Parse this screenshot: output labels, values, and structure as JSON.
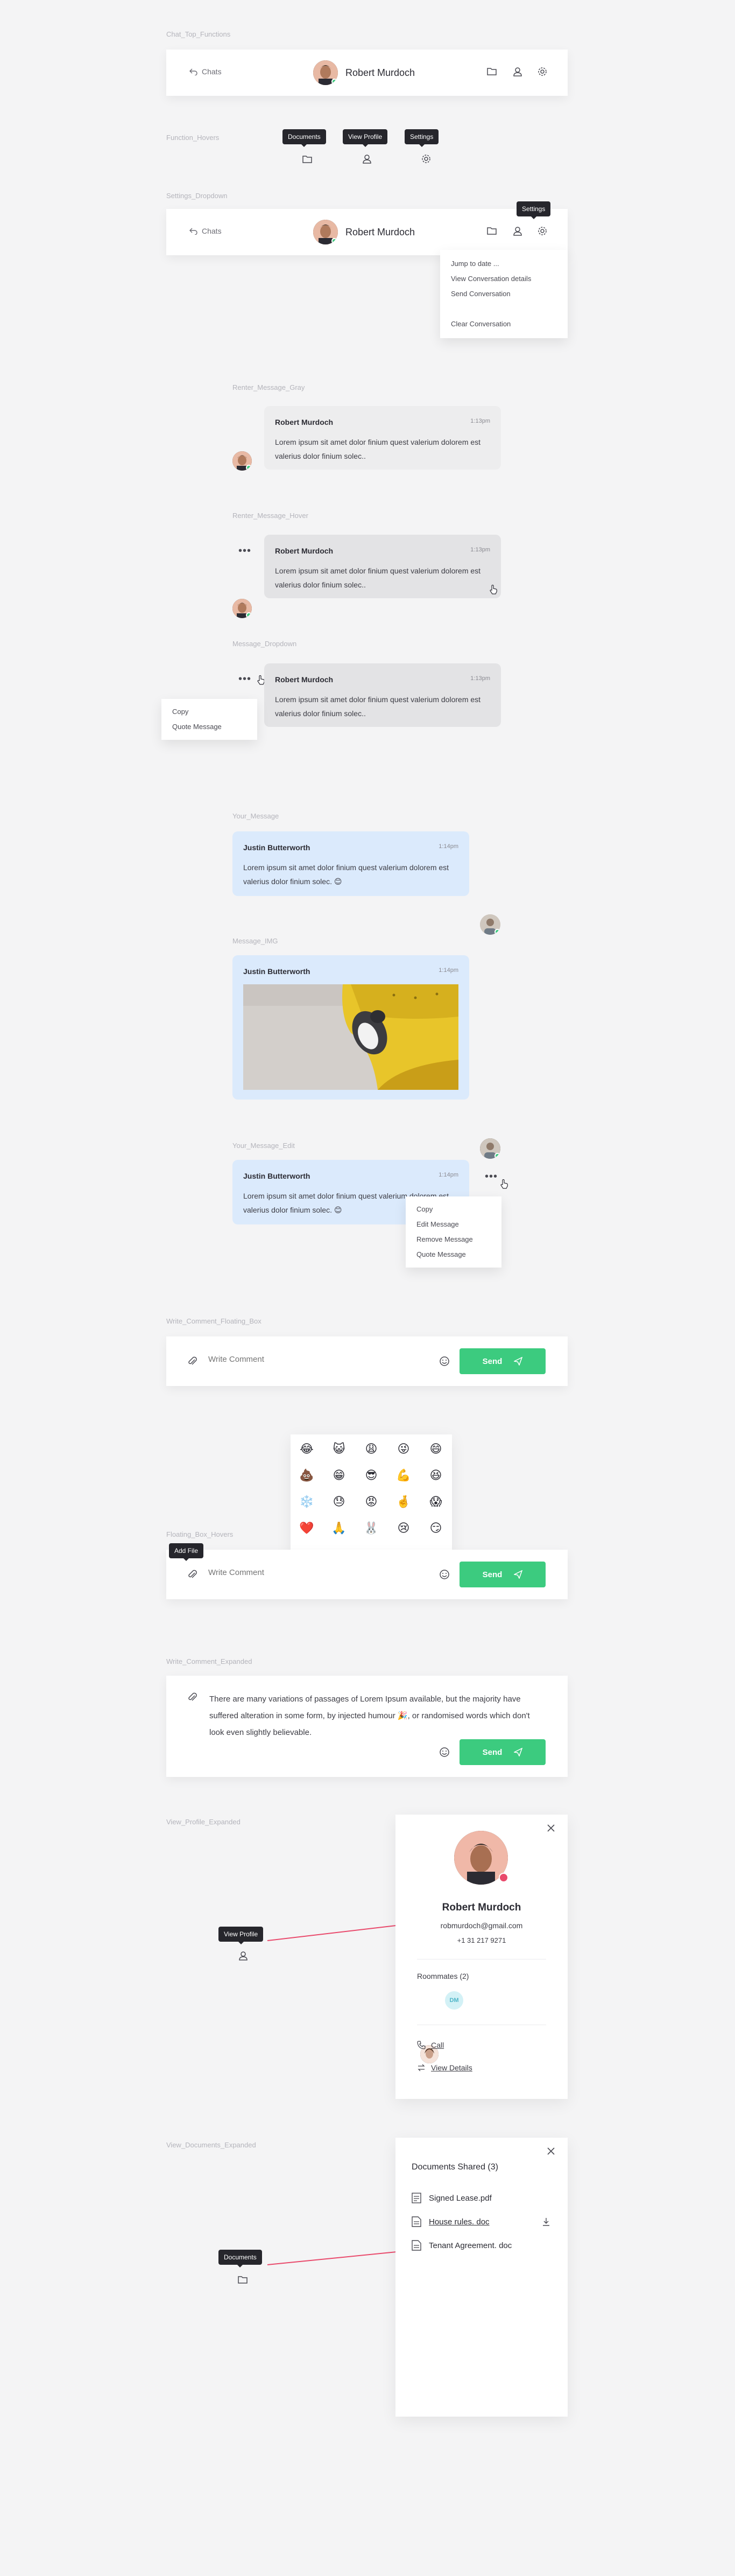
{
  "sections": {
    "chat_top_functions": "Chat_Top_Functions",
    "function_hovers": "Function_Hovers",
    "settings_dropdown": "Settings_Dropdown",
    "renter_message_gray": "Renter_Message_Gray",
    "renter_message_hover": "Renter_Message_Hover",
    "message_dropdown": "Message_Dropdown",
    "your_message": "Your_Message",
    "message_img": "Message_IMG",
    "your_message_edit": "Your_Message_Edit",
    "write_comment_floating_box": "Write_Comment_Floating_Box",
    "floating_box_hovers": "Floating_Box_Hovers",
    "write_comment_expanded": "Write_Comment_Expanded",
    "view_profile_expanded": "View_Profile_Expanded",
    "view_documents_expanded": "View_Documents_Expanded"
  },
  "topbar": {
    "back_label": "Chats",
    "user_name": "Robert Murdoch",
    "icons": [
      "folder-icon",
      "user-icon",
      "gear-icon"
    ]
  },
  "tooltips": {
    "documents": "Documents",
    "view_profile": "View Profile",
    "settings": "Settings",
    "add_file": "Add File"
  },
  "settings_menu": {
    "items": [
      "Jump to date ...",
      "View Conversation details",
      "Send Conversation",
      "Clear Conversation"
    ]
  },
  "renter_message": {
    "name": "Robert Murdoch",
    "time": "1:13pm",
    "text": "Lorem ipsum sit amet dolor finium quest valerium dolorem est valerius dolor finium solec.."
  },
  "message_menu": {
    "items": [
      "Copy",
      "Quote Message"
    ]
  },
  "your_message": {
    "name": "Justin Butterworth",
    "time": "1:14pm",
    "text": "Lorem ipsum sit amet dolor finium quest valerium dolorem est valerius dolor finium solec. 😊"
  },
  "edit_menu": {
    "items": [
      "Copy",
      "Edit Message",
      "Remove Message",
      "Quote Message"
    ]
  },
  "composer": {
    "placeholder": "Write Comment",
    "send_label": "Send",
    "expanded_text": "There are many variations of passages of Lorem Ipsum available, but the majority have suffered alteration in some form, by injected humour 🎉, or randomised words which don't look even slightly believable."
  },
  "emojis": [
    "😂",
    "😺",
    "😩",
    "😜",
    "😄",
    "💩",
    "😁",
    "😎",
    "💪",
    "😆",
    "❄️",
    "😓",
    "😡",
    "🤞",
    "😱",
    "❤️",
    "🙏",
    "🐰",
    "😢",
    "😏"
  ],
  "profile": {
    "name": "Robert Murdoch",
    "email": "robmurdoch@gmail.com",
    "phone": "+1 31 217 9271",
    "roommates_label": "Roommates (2)",
    "roommate_initials": "DM",
    "call_label": "Call",
    "details_label": "View Details"
  },
  "documents": {
    "title": "Documents Shared (3)",
    "files": [
      "Signed Lease.pdf",
      "House rules. doc",
      "Tenant Agreement. doc"
    ]
  },
  "colors": {
    "accent_green": "#3ccb7f",
    "tooltip_dark": "#26262c",
    "my_bubble": "#dbeafc",
    "arrow_red": "#e94a6c"
  }
}
